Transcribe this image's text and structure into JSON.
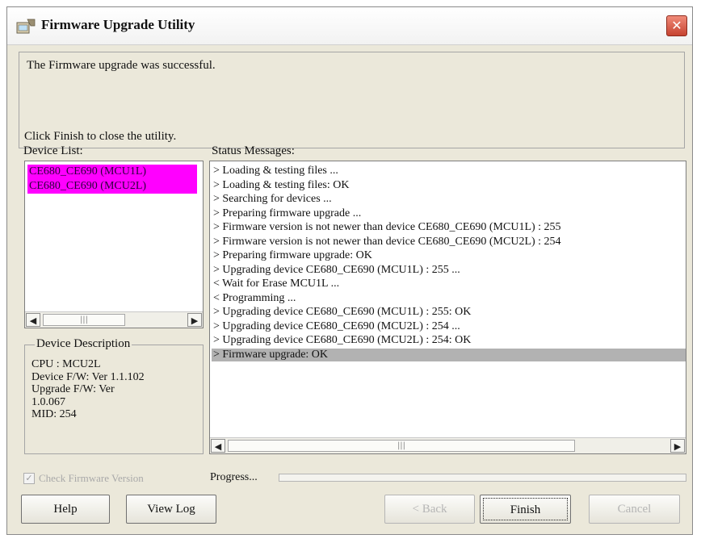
{
  "window": {
    "title": "Firmware Upgrade Utility"
  },
  "message": {
    "line1": "The Firmware upgrade was successful.",
    "line2": "Click Finish to close the utility."
  },
  "device_list": {
    "label": "Device List:",
    "items": [
      "CE680_CE690 (MCU1L)",
      "CE680_CE690 (MCU2L)"
    ]
  },
  "device_description": {
    "legend": "Device Description",
    "lines": [
      "CPU : MCU2L",
      "Device F/W: Ver 1.1.102",
      "Upgrade F/W: Ver",
      "1.0.067",
      "MID: 254"
    ]
  },
  "status": {
    "label": "Status Messages:",
    "lines": [
      "> Loading & testing files ...",
      "> Loading & testing files: OK",
      "> Searching for devices ...",
      "> Preparing firmware upgrade ...",
      "> Firmware version is not newer than device CE680_CE690 (MCU1L) : 255",
      "> Firmware version is not newer than device CE680_CE690 (MCU2L) : 254",
      "> Preparing firmware upgrade: OK",
      "> Upgrading device CE680_CE690 (MCU1L) : 255 ...",
      "< Wait for Erase MCU1L ...",
      "< Programming ...",
      "> Upgrading device CE680_CE690 (MCU1L) : 255: OK",
      "> Upgrading device CE680_CE690 (MCU2L) : 254 ...",
      "> Upgrading device CE680_CE690 (MCU2L) : 254: OK",
      "> Firmware upgrade: OK"
    ],
    "selected_index": 13
  },
  "check_firmware": {
    "label": "Check Firmware Version",
    "checked": true
  },
  "progress": {
    "label": "Progress...",
    "value": 0
  },
  "buttons": {
    "help": "Help",
    "view_log": "View Log",
    "back": "< Back",
    "finish": "Finish",
    "cancel": "Cancel"
  },
  "colors": {
    "selection": "#ff00ff",
    "status_highlight": "#b2b2b2",
    "close": "#d9503c"
  }
}
